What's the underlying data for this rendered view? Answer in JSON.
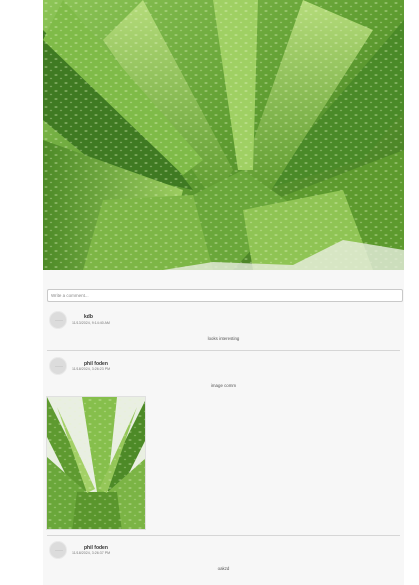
{
  "comment_box": {
    "placeholder": "Write a comment..."
  },
  "comments": [
    {
      "author": "kdb",
      "timestamp": "11/13/2024, 9:14:40 AM",
      "text": "looks interesting"
    },
    {
      "author": "phil foden",
      "timestamp": "11/18/2024, 3:26:23 PM",
      "text": "image comm"
    },
    {
      "author": "phil foden",
      "timestamp": "11/18/2024, 3:26:37 PM",
      "text": "oakzd"
    }
  ],
  "colors": {
    "leaf_dark": "#3f7a22",
    "leaf_mid": "#6aa73a",
    "leaf_light": "#a8d46f",
    "card_bg": "#f7f7f7"
  },
  "icons": {
    "avatar": "user-avatar-icon"
  }
}
